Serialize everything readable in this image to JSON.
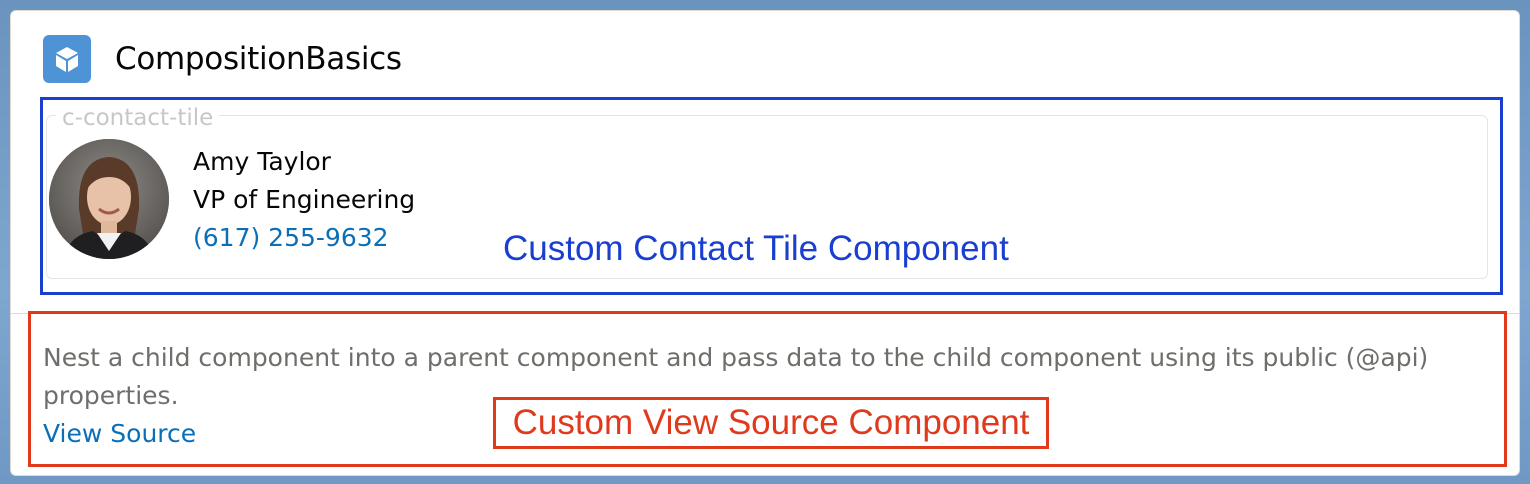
{
  "header": {
    "title": "CompositionBasics",
    "icon": "cube-icon",
    "icon_color": "#4f93d7"
  },
  "contact_tile": {
    "legend": "c-contact-tile",
    "name": "Amy Taylor",
    "job_title": "VP of Engineering",
    "phone": "(617) 255-9632",
    "avatar": "avatar-photo"
  },
  "annotations": {
    "contact_tile_label": "Custom Contact Tile Component",
    "contact_tile_color": "#1a3fd0",
    "view_source_label": "Custom View Source Component",
    "view_source_color": "#e0391c"
  },
  "view_source": {
    "description": "Nest a child component into a parent component and pass data to the child component using its public (@api) properties.",
    "link_label": "View Source"
  },
  "colors": {
    "link": "#0b6fb8",
    "muted_text": "#706e6b"
  }
}
